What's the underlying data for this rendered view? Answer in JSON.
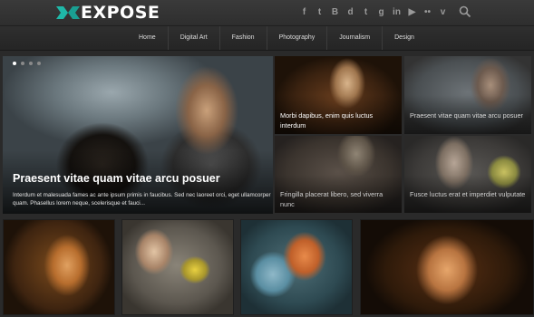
{
  "header": {
    "logo_text": "EXPOSE",
    "logo_color": "#1fb8a8",
    "social_icons": [
      "facebook-icon",
      "twitter-icon",
      "blogger-icon",
      "digg-icon",
      "tumblr-icon",
      "googleplus-icon",
      "linkedin-icon",
      "youtube-icon",
      "flickr-icon",
      "vimeo-icon"
    ],
    "social_glyphs": [
      "f",
      "t",
      "B",
      "d",
      "t",
      "g",
      "in",
      "▶",
      "••",
      "v"
    ]
  },
  "nav": {
    "items": [
      "Home",
      "Digital Art",
      "Fashion",
      "Photography",
      "Journalism",
      "Design"
    ]
  },
  "slider": {
    "title": "Praesent vitae quam vitae arcu posuer",
    "excerpt": "Interdum et malesuada fames ac ante ipsum primis in faucibus. Sed nec laoreet orci, eget ullamcorper quam. Phasellus lorem neque, scelerisque et fauci...",
    "dot_count": 4,
    "active_dot": 0
  },
  "tiles": [
    {
      "caption": "Morbi dapibus, enim quis luctus interdum"
    },
    {
      "caption": "Praesent vitae quam vitae arcu posuer"
    },
    {
      "caption": "Fringilla placerat libero, sed viverra nunc"
    },
    {
      "caption": "Fusce luctus erat et imperdiet vulputate"
    }
  ]
}
